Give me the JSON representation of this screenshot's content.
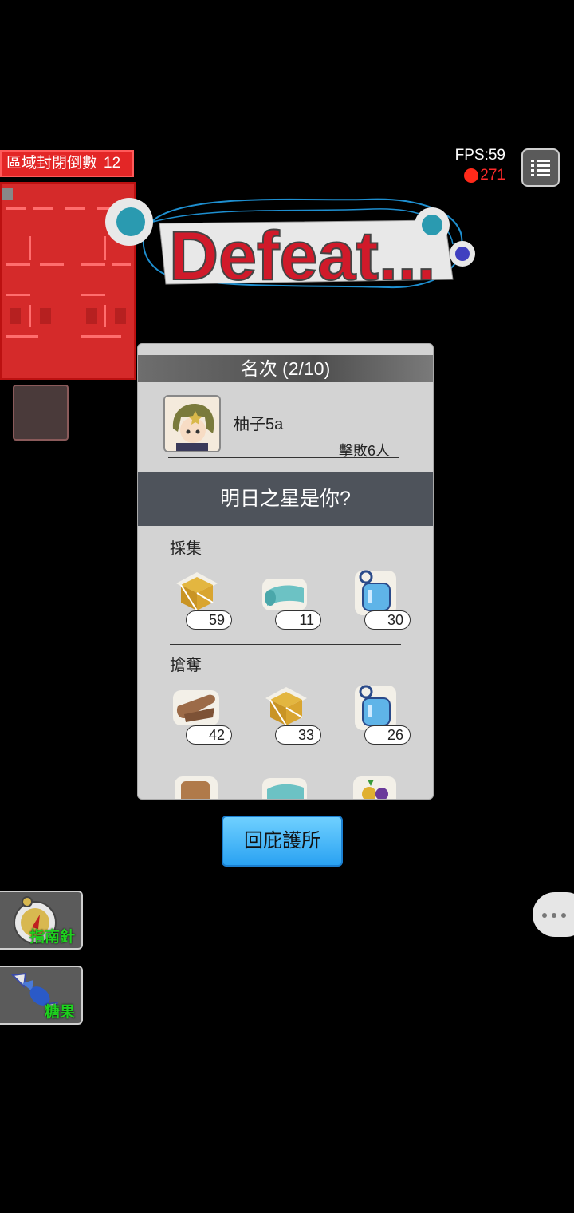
{
  "hud": {
    "zone_close_label": "區域封閉倒數",
    "zone_close_count": "12",
    "fps": "FPS:59",
    "ping": "271"
  },
  "banner": {
    "text": "Defeat..."
  },
  "result": {
    "rank_title": "名次 (2/10)",
    "player_name": "柚子5a",
    "defeated_text": "擊敗6人",
    "slogan": "明日之星是你?",
    "gather_title": "採集",
    "gather_items": [
      {
        "icon": "wooden-crate-icon",
        "count": "59"
      },
      {
        "icon": "cloth-roll-icon",
        "count": "11"
      },
      {
        "icon": "water-bottle-icon",
        "count": "30"
      }
    ],
    "loot_title": "搶奪",
    "loot_items": [
      {
        "icon": "leather-scroll-icon",
        "count": "42"
      },
      {
        "icon": "wooden-crate-icon",
        "count": "33"
      },
      {
        "icon": "water-bottle-icon",
        "count": "26"
      }
    ]
  },
  "actions": {
    "return_label": "回庇護所"
  },
  "side_items": [
    {
      "icon": "compass-icon",
      "label": "指南針"
    },
    {
      "icon": "candy-icon",
      "label": "糖果"
    }
  ],
  "colors": {
    "timer_red": "#e32626",
    "ping_red": "#ff2a2a",
    "return_blue": "#2aa2f2",
    "item_label_green": "#1ed21e"
  }
}
